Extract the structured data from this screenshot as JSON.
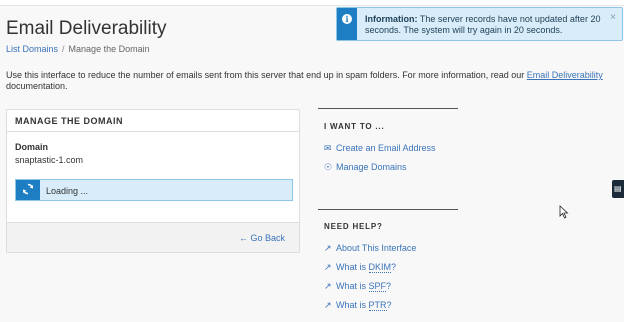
{
  "header": {
    "title": "Email Deliverability",
    "breadcrumb": {
      "parent": "List Domains",
      "separator": "/",
      "current": "Manage the Domain"
    }
  },
  "notification": {
    "icon": "info-icon",
    "label": "Information:",
    "message": "The server records have not updated after 20 seconds. The system will try again in 20 seconds.",
    "close": "×"
  },
  "intro": {
    "text": "Use this interface to reduce the number of emails sent from this server that end up in spam folders. For more information, read our",
    "link": "Email Deliverability",
    "suffix": "documentation."
  },
  "manage_panel": {
    "heading": "MANAGE THE DOMAIN",
    "domain_label": "Domain",
    "domain_value": "snaptastic-1.com",
    "loading_text": "Loading ...",
    "go_back": "Go Back"
  },
  "sidebar": {
    "want_heading": "I WANT TO ...",
    "want_links": [
      "Create an Email Address",
      "Manage Domains"
    ],
    "help_heading": "NEED HELP?",
    "help_links": {
      "about": "About This Interface",
      "dkim_prefix": "What is ",
      "dkim": "DKIM",
      "dkim_suffix": "?",
      "spf_prefix": "What is ",
      "spf": "SPF",
      "spf_suffix": "?",
      "ptr_prefix": "What is ",
      "ptr": "PTR",
      "ptr_suffix": "?"
    }
  },
  "colors": {
    "link": "#3b74b8",
    "info_accent": "#1d7ec4",
    "info_bg": "#d8edf9",
    "background": "#f8f8f8"
  }
}
